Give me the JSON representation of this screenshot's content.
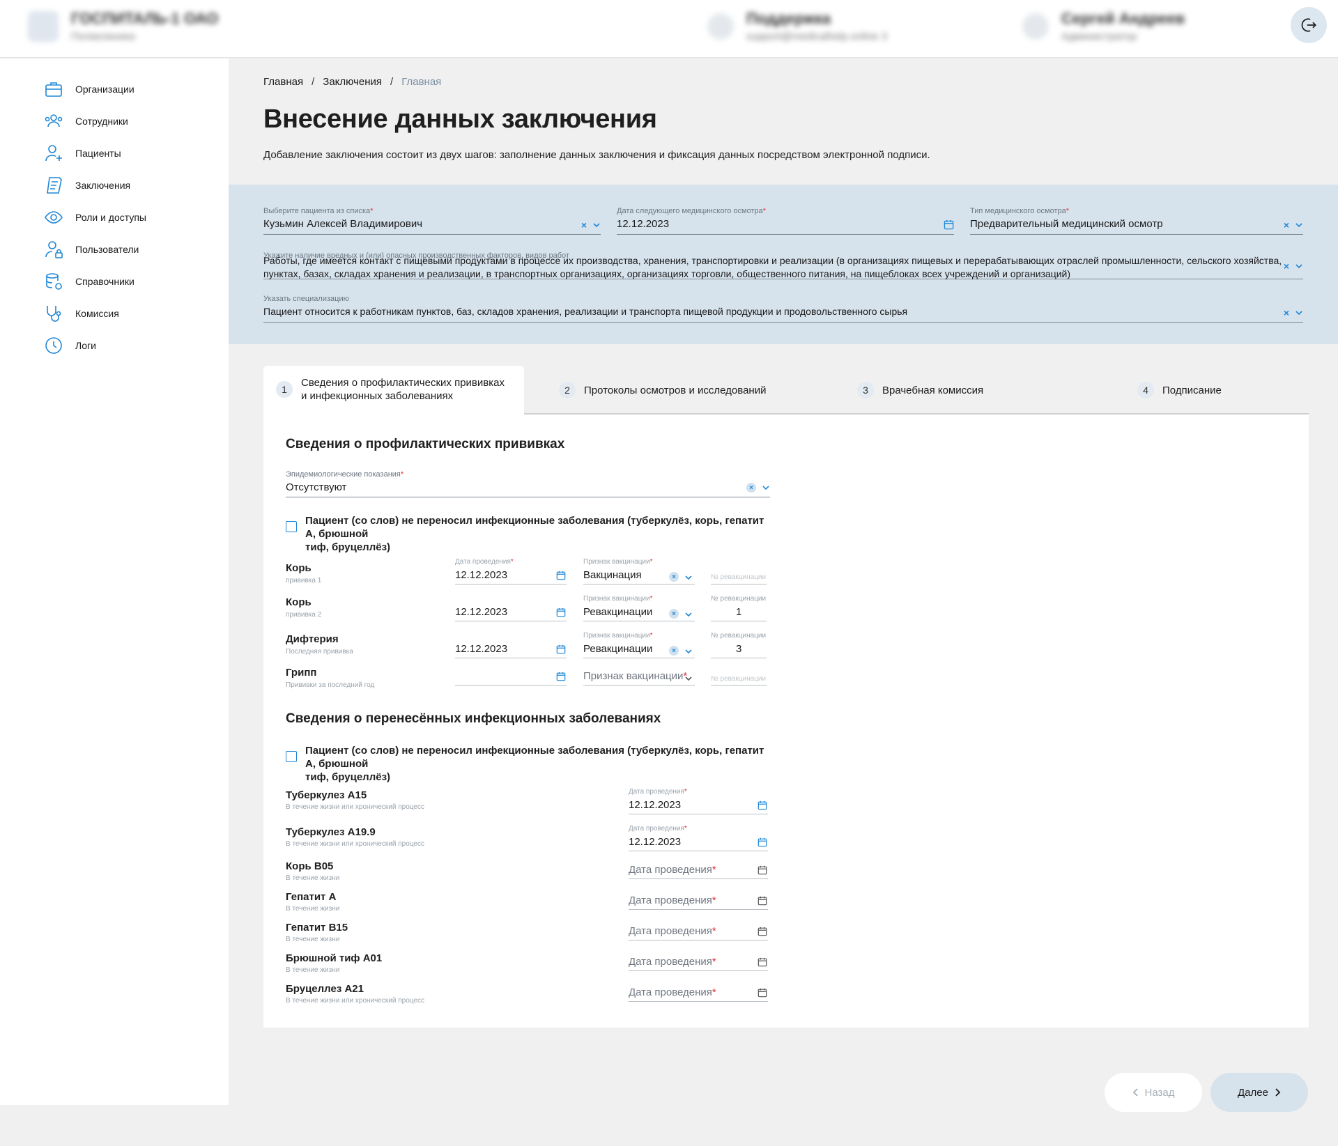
{
  "header": {
    "org_name": "ГОСПИТАЛЬ-1 ОАО",
    "org_sub": "Поликлиника",
    "contact_name": "Поддержка",
    "contact_sub": "support@medicalhelp.online",
    "contact_badge": "3",
    "user_name": "Сергей Андреев",
    "user_sub": "Администратор"
  },
  "sidebar": {
    "items": [
      {
        "label": "Организации",
        "icon": "briefcase-icon"
      },
      {
        "label": "Сотрудники",
        "icon": "employees-icon"
      },
      {
        "label": "Пациенты",
        "icon": "user-plus-icon"
      },
      {
        "label": "Заключения",
        "icon": "document-icon"
      },
      {
        "label": "Роли и доступы",
        "icon": "eye-icon"
      },
      {
        "label": "Пользователи",
        "icon": "user-lock-icon"
      },
      {
        "label": "Справочники",
        "icon": "database-icon"
      },
      {
        "label": "Комиссия",
        "icon": "stethoscope-icon"
      },
      {
        "label": "Логи",
        "icon": "clock-icon"
      }
    ]
  },
  "breadcrumb": [
    "Главная",
    "Заключения",
    "Главная"
  ],
  "page": {
    "title": "Внесение данных заключения",
    "description": "Добавление заключения состоит из двух шагов: заполнение данных заключения и фиксация данных посредством электронной подписи."
  },
  "form": {
    "patient_label": "Выберите пациента из списка",
    "patient_value": "Кузьмин Алексей Владимирович",
    "next_exam_label": "Дата следующего медицинского осмотра",
    "next_exam_value": "12.12.2023",
    "exam_type_label": "Тип медицинского осмотра",
    "exam_type_value": "Предварительный медицинский осмотр",
    "factors_label": "Укажите наличие вредных и (или) опасных производственных факторов, видов работ",
    "factors_value_line1": "Работы, где имеется контакт с пищевыми продуктами в процессе их производства, хранения, транспортировки и реализации (в организациях пищевых и перерабатывающих отраслей промышленности, сельского хозяйства,",
    "factors_value_line2": "пунктах, базах, складах хранения и реализации, в транспортных организациях, организациях торговли, общественного питания, на пищеблоках всех учреждений и организаций)",
    "spec_label": "Указать специализацию",
    "spec_value": "Пациент относится к работникам пунктов, баз, складов хранения, реализации и транспорта пищевой продукции и продовольственного сырья"
  },
  "tabs": [
    {
      "num": "1",
      "label_line1": "Сведения о профилактических прививках",
      "label_line2": "и инфекционных заболеваниях"
    },
    {
      "num": "2",
      "label": "Протоколы осмотров и исследований"
    },
    {
      "num": "3",
      "label": "Врачебная комиссия"
    },
    {
      "num": "4",
      "label": "Подписание"
    }
  ],
  "vaccinations": {
    "title": "Сведения о профилактических прививках",
    "epid_label": "Эпидемиологические показания",
    "epid_value": "Отсутствуют",
    "checkbox_line1": "Пациент (со слов) не переносил инфекционные заболевания (туберкулёз, корь, гепатит А, брюшной",
    "checkbox_line2": "тиф, бруцеллёз)",
    "date_label": "Дата проведения",
    "sign_label": "Признак вакцинации",
    "revac_label": "№ ревакцинации",
    "rows": [
      {
        "name": "Корь",
        "sub": "прививка 1",
        "date": "12.12.2023",
        "sign": "Вакцинация",
        "revac": ""
      },
      {
        "name": "Корь",
        "sub": "прививка 2",
        "date": "12.12.2023",
        "sign": "Ревакцинации",
        "revac": "1"
      },
      {
        "name": "Дифтерия",
        "sub": "Последняя прививка",
        "date": "12.12.2023",
        "sign": "Ревакцинации",
        "revac": "3"
      },
      {
        "name": "Грипп",
        "sub": "Прививки за последний год",
        "date": "",
        "sign": "",
        "revac": ""
      }
    ]
  },
  "diseases": {
    "title": "Сведения о перенесённых инфекционных заболеваниях",
    "checkbox_line1": "Пациент (со слов) не переносил инфекционные заболевания (туберкулёз, корь, гепатит А, брюшной",
    "checkbox_line2": "тиф, бруцеллёз)",
    "date_label": "Дата проведения",
    "rows": [
      {
        "name": "Туберкулез А15",
        "sub": "В течение жизни или хронический процесс",
        "date": "12.12.2023"
      },
      {
        "name": "Туберкулез А19.9",
        "sub": "В течение жизни или хронический процесс",
        "date": "12.12.2023"
      },
      {
        "name": "Корь В05",
        "sub": "В течение жизни",
        "date": ""
      },
      {
        "name": "Гепатит А",
        "sub": "В течение жизни",
        "date": ""
      },
      {
        "name": "Гепатит В15",
        "sub": "В течение жизни",
        "date": ""
      },
      {
        "name": "Брюшной тиф А01",
        "sub": "В течение жизни",
        "date": ""
      },
      {
        "name": "Бруцеллез А21",
        "sub": "В течение жизни или хронический процесс",
        "date": ""
      }
    ]
  },
  "buttons": {
    "back": "Назад",
    "next": "Далее"
  },
  "colors": {
    "accent": "#1f87d6",
    "panel": "#d6e2ec",
    "required": "#e0303a"
  }
}
